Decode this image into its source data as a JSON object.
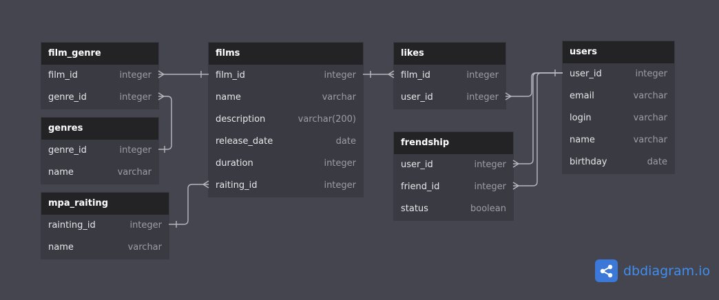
{
  "tables": {
    "film_genre": {
      "title": "film_genre",
      "fields": [
        {
          "name": "film_id",
          "type": "integer"
        },
        {
          "name": "genre_id",
          "type": "integer"
        }
      ]
    },
    "genres": {
      "title": "genres",
      "fields": [
        {
          "name": "genre_id",
          "type": "integer"
        },
        {
          "name": "name",
          "type": "varchar"
        }
      ]
    },
    "mpa_raiting": {
      "title": "mpa_raiting",
      "fields": [
        {
          "name": "rainting_id",
          "type": "integer"
        },
        {
          "name": "name",
          "type": "varchar"
        }
      ]
    },
    "films": {
      "title": "films",
      "fields": [
        {
          "name": "film_id",
          "type": "integer"
        },
        {
          "name": "name",
          "type": "varchar"
        },
        {
          "name": "description",
          "type": "varchar(200)"
        },
        {
          "name": "release_date",
          "type": "date"
        },
        {
          "name": "duration",
          "type": "integer"
        },
        {
          "name": "raiting_id",
          "type": "integer"
        }
      ]
    },
    "likes": {
      "title": "likes",
      "fields": [
        {
          "name": "film_id",
          "type": "integer"
        },
        {
          "name": "user_id",
          "type": "integer"
        }
      ]
    },
    "frendship": {
      "title": "frendship",
      "fields": [
        {
          "name": "user_id",
          "type": "integer"
        },
        {
          "name": "friend_id",
          "type": "integer"
        },
        {
          "name": "status",
          "type": "boolean"
        }
      ]
    },
    "users": {
      "title": "users",
      "fields": [
        {
          "name": "user_id",
          "type": "integer"
        },
        {
          "name": "email",
          "type": "varchar"
        },
        {
          "name": "login",
          "type": "varchar"
        },
        {
          "name": "name",
          "type": "varchar"
        },
        {
          "name": "birthday",
          "type": "date"
        }
      ]
    }
  },
  "brand": {
    "name": "dbdiagram.io",
    "icon": "share-nodes-icon",
    "color": "#3f8ef0"
  },
  "colors": {
    "background": "#45454f",
    "header": "#232325",
    "body": "#3a3a42",
    "relation": "#b8b8c0"
  }
}
